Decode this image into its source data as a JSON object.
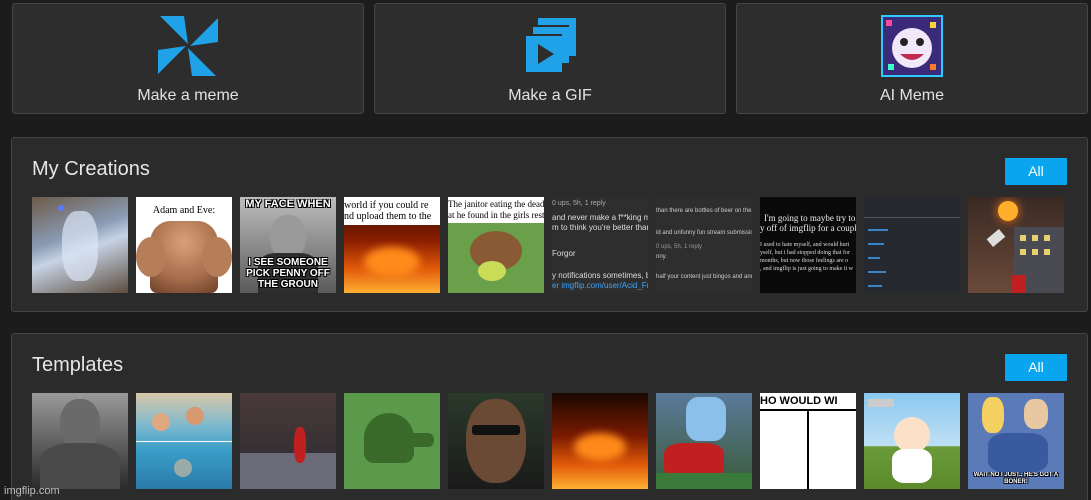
{
  "actions": [
    {
      "label": "Make a meme",
      "icon": "pinwheel-icon"
    },
    {
      "label": "Make a GIF",
      "icon": "gif-stack-icon"
    },
    {
      "label": "AI Meme",
      "icon": "ai-face-icon"
    }
  ],
  "my_creations": {
    "title": "My Creations",
    "all_label": "All",
    "items": [
      {
        "caption": ""
      },
      {
        "caption": "Adam and Eve:"
      },
      {
        "top": "MY FACE WHEN",
        "bottom": "I SEE SOMEONE PICK PENNY OFF THE GROUN"
      },
      {
        "caption": "world if you could re\nnd upload them to the"
      },
      {
        "caption": "The janitor eating the dead\nat he found in the girls restr"
      },
      {
        "lines": [
          "0 ups, 5h, 1 reply",
          "and never make a f**king mis",
          "m to think you're better than",
          "Forgor",
          "y notifications sometimes, bu",
          "er imgflip.com/user/Acid_Fr"
        ]
      },
      {
        "lines": [
          "than there are bottles of beer on the w",
          "id and unfunny fun stream submissions",
          "0 ups, 5h, 1 reply",
          "nny.",
          "half your content just bingos and anno"
        ]
      },
      {
        "lines": [
          "I'm going to maybe try to",
          "y off of imgflip for a couple o",
          "I used to hate myself, and would hurt",
          "yself, but i had stopped doing that for",
          "months, but now those feelings are o",
          ", and imgflip is just going to make it w"
        ]
      },
      {
        "caption": ""
      },
      {
        "caption": ""
      }
    ]
  },
  "templates": {
    "title": "Templates",
    "all_label": "All",
    "items": [
      {
        "caption": ""
      },
      {
        "caption": ""
      },
      {
        "caption": ""
      },
      {
        "caption": ""
      },
      {
        "caption": ""
      },
      {
        "caption": ""
      },
      {
        "caption": ""
      },
      {
        "caption": "HO WOULD WI"
      },
      {
        "caption": ""
      },
      {
        "caption": "WAIT NO I JUST.. HE'S GOT A BONER!"
      }
    ]
  },
  "watermark": "imgflip.com",
  "colors": {
    "accent": "#0aa5ef",
    "card": "#2d2d2d",
    "page": "#1c1c1c"
  }
}
